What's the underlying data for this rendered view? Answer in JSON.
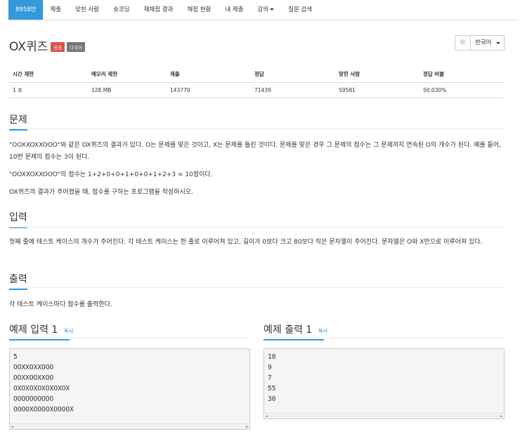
{
  "nav": {
    "tabs": [
      {
        "label": "8958번"
      },
      {
        "label": "제출"
      },
      {
        "label": "맞힌 사람"
      },
      {
        "label": "숏코딩"
      },
      {
        "label": "재채점 결과"
      },
      {
        "label": "채점 현황"
      },
      {
        "label": "내 제출"
      },
      {
        "label": "강의"
      },
      {
        "label": "질문 검색"
      }
    ]
  },
  "problem": {
    "title": "OX퀴즈",
    "badges": [
      "성공",
      "다국어"
    ]
  },
  "toolbar": {
    "star": "☆",
    "language": "한국어"
  },
  "stats": {
    "headers": [
      "시간 제한",
      "메모리 제한",
      "제출",
      "정답",
      "맞힌 사람",
      "정답 비율"
    ],
    "values": [
      "1 초",
      "128 MB",
      "143770",
      "71439",
      "59581",
      "50.030%"
    ]
  },
  "sections": {
    "problem": {
      "heading": "문제",
      "paragraphs": [
        "\"OOXXOXXOOO\"와 같은 OX퀴즈의 결과가 있다. O는 문제를 맞은 것이고, X는 문제를 틀린 것이다. 문제를 맞은 경우 그 문제의 점수는 그 문제까지 연속된 O의 개수가 된다. 예를 들어, 10번 문제의 점수는 3이 된다.",
        "\"OOXXOXXOOO\"의 점수는 1+2+0+0+1+0+0+1+2+3 = 10점이다.",
        "OX퀴즈의 결과가 주어졌을 때, 점수를 구하는 프로그램을 작성하시오."
      ]
    },
    "input": {
      "heading": "입력",
      "text": "첫째 줄에 테스트 케이스의 개수가 주어진다. 각 테스트 케이스는 한 줄로 이루어져 있고, 길이가 0보다 크고 80보다 작은 문자열이 주어진다. 문자열은 O와 X만으로 이루어져 있다."
    },
    "output": {
      "heading": "출력",
      "text": "각 테스트 케이스마다 점수를 출력한다."
    }
  },
  "samples": {
    "input": {
      "heading": "예제 입력 1",
      "copy": "복사",
      "lines": [
        "5",
        "OOXXOXXOOO",
        "OOXXOOXXOO",
        "OXOXOXOXOXOXOX",
        "OOOOOOOOOO",
        "OOOOXOOOOXOOOOX"
      ]
    },
    "output": {
      "heading": "예제 출력 1",
      "copy": "복사",
      "lines": [
        "10",
        "9",
        "7",
        "55",
        "30"
      ]
    }
  }
}
